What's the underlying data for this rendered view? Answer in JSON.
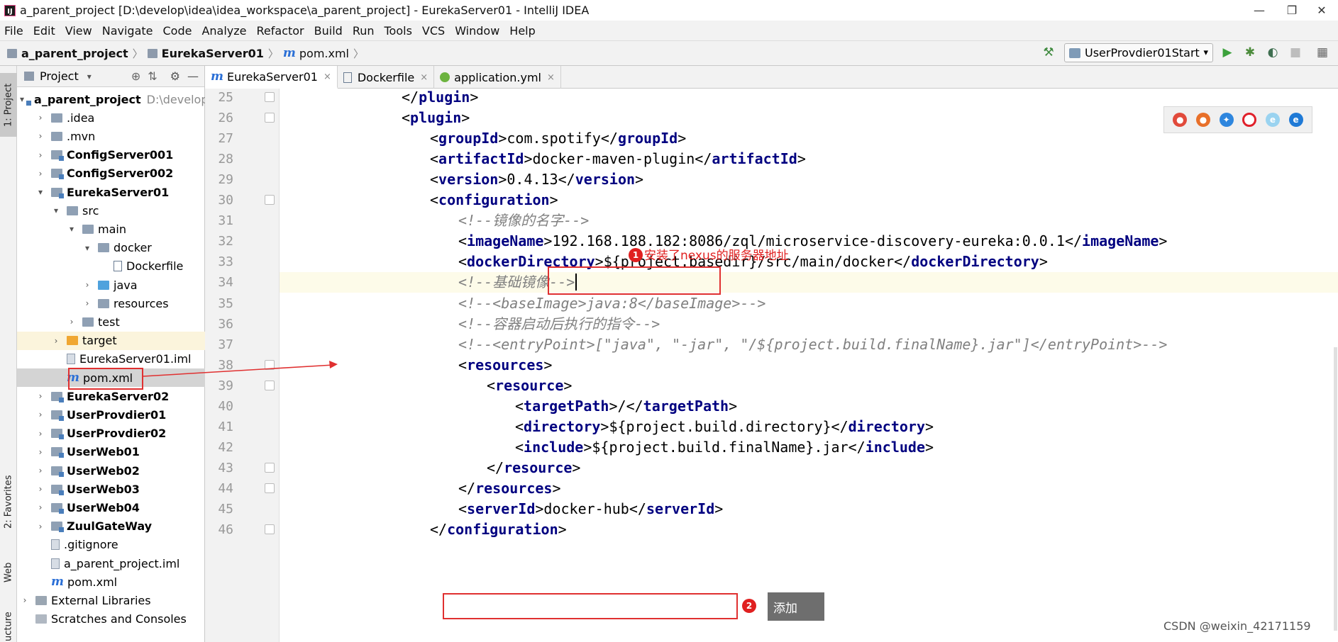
{
  "window": {
    "title": "a_parent_project [D:\\develop\\idea\\idea_workspace\\a_parent_project] - EurekaServer01 - IntelliJ IDEA",
    "controls": {
      "minimize": "—",
      "maximize": "❐",
      "close": "✕"
    }
  },
  "menu": [
    "File",
    "Edit",
    "View",
    "Navigate",
    "Code",
    "Analyze",
    "Refactor",
    "Build",
    "Run",
    "Tools",
    "VCS",
    "Window",
    "Help"
  ],
  "breadcrumb": {
    "project": "a_parent_project",
    "module": "EurekaServer01",
    "file_icon": "m",
    "file": "pom.xml"
  },
  "toolbar": {
    "run_config": "UserProvdier01Start",
    "dropdown_glyph": "▾",
    "build_icon": "hammer-icon",
    "run_icon": "play-icon",
    "debug_icon": "bug-icon",
    "coverage_icon": "coverage-icon",
    "stop_icon": "stop-icon"
  },
  "side_tabs": {
    "project": "1: Project",
    "favorites": "2: Favorites",
    "web": "Web",
    "structure": "ucture"
  },
  "project_panel": {
    "title": "Project",
    "dropdown": "▾"
  },
  "tree": [
    {
      "label": "a_parent_project",
      "suffix": "D:\\develop",
      "bold": true,
      "depth": 0,
      "arrow": "▾",
      "icon": "folder-mod"
    },
    {
      "label": ".idea",
      "depth": 1,
      "arrow": "›",
      "icon": "folder"
    },
    {
      "label": ".mvn",
      "depth": 1,
      "arrow": "›",
      "icon": "folder"
    },
    {
      "label": "ConfigServer001",
      "bold": true,
      "depth": 1,
      "arrow": "›",
      "icon": "folder-mod"
    },
    {
      "label": "ConfigServer002",
      "bold": true,
      "depth": 1,
      "arrow": "›",
      "icon": "folder-mod"
    },
    {
      "label": "EurekaServer01",
      "bold": true,
      "depth": 1,
      "arrow": "▾",
      "icon": "folder-mod"
    },
    {
      "label": "src",
      "depth": 2,
      "arrow": "▾",
      "icon": "folder"
    },
    {
      "label": "main",
      "depth": 3,
      "arrow": "▾",
      "icon": "folder"
    },
    {
      "label": "docker",
      "depth": 4,
      "arrow": "▾",
      "icon": "folder"
    },
    {
      "label": "Dockerfile",
      "depth": 5,
      "arrow": "",
      "icon": "file-docker"
    },
    {
      "label": "java",
      "depth": 4,
      "arrow": "›",
      "icon": "folder-blue"
    },
    {
      "label": "resources",
      "depth": 4,
      "arrow": "›",
      "icon": "folder"
    },
    {
      "label": "test",
      "depth": 3,
      "arrow": "›",
      "icon": "folder"
    },
    {
      "label": "target",
      "depth": 2,
      "arrow": "›",
      "icon": "folder-orange",
      "highlight": true
    },
    {
      "label": "EurekaServer01.iml",
      "depth": 2,
      "arrow": "",
      "icon": "file"
    },
    {
      "label": "pom.xml",
      "depth": 2,
      "arrow": "",
      "icon": "m",
      "selected": true
    },
    {
      "label": "EurekaServer02",
      "bold": true,
      "depth": 1,
      "arrow": "›",
      "icon": "folder-mod"
    },
    {
      "label": "UserProvdier01",
      "bold": true,
      "depth": 1,
      "arrow": "›",
      "icon": "folder-mod"
    },
    {
      "label": "UserProvdier02",
      "bold": true,
      "depth": 1,
      "arrow": "›",
      "icon": "folder-mod"
    },
    {
      "label": "UserWeb01",
      "bold": true,
      "depth": 1,
      "arrow": "›",
      "icon": "folder-mod"
    },
    {
      "label": "UserWeb02",
      "bold": true,
      "depth": 1,
      "arrow": "›",
      "icon": "folder-mod"
    },
    {
      "label": "UserWeb03",
      "bold": true,
      "depth": 1,
      "arrow": "›",
      "icon": "folder-mod"
    },
    {
      "label": "UserWeb04",
      "bold": true,
      "depth": 1,
      "arrow": "›",
      "icon": "folder-mod"
    },
    {
      "label": "ZuulGateWay",
      "bold": true,
      "depth": 1,
      "arrow": "›",
      "icon": "folder-mod"
    },
    {
      "label": ".gitignore",
      "depth": 1,
      "arrow": "",
      "icon": "file"
    },
    {
      "label": "a_parent_project.iml",
      "depth": 1,
      "arrow": "",
      "icon": "file"
    },
    {
      "label": "pom.xml",
      "depth": 1,
      "arrow": "",
      "icon": "m"
    },
    {
      "label": "External Libraries",
      "depth": 0,
      "arrow": "›",
      "icon": "lib"
    },
    {
      "label": "Scratches and Consoles",
      "depth": 0,
      "arrow": "",
      "icon": "scratch"
    }
  ],
  "tabs": [
    {
      "icon": "m",
      "label": "EurekaServer01",
      "close": "×",
      "active": true
    },
    {
      "icon": "docker",
      "label": "Dockerfile",
      "close": "×"
    },
    {
      "icon": "yml",
      "label": "application.yml",
      "close": "×"
    }
  ],
  "code": [
    {
      "n": "25",
      "parts": [
        {
          "t": "br",
          "v": "</"
        },
        {
          "t": "tag",
          "v": "plugin"
        },
        {
          "t": "br",
          "v": ">"
        }
      ],
      "indent": 3
    },
    {
      "n": "26",
      "parts": [
        {
          "t": "br",
          "v": "<"
        },
        {
          "t": "tag",
          "v": "plugin"
        },
        {
          "t": "br",
          "v": ">"
        }
      ],
      "indent": 3
    },
    {
      "n": "27",
      "parts": [
        {
          "t": "br",
          "v": "<"
        },
        {
          "t": "tag",
          "v": "groupId"
        },
        {
          "t": "br",
          "v": ">"
        },
        {
          "t": "txt",
          "v": "com.spotify"
        },
        {
          "t": "br",
          "v": "</"
        },
        {
          "t": "tag",
          "v": "groupId"
        },
        {
          "t": "br",
          "v": ">"
        }
      ],
      "indent": 4
    },
    {
      "n": "28",
      "parts": [
        {
          "t": "br",
          "v": "<"
        },
        {
          "t": "tag",
          "v": "artifactId"
        },
        {
          "t": "br",
          "v": ">"
        },
        {
          "t": "txt",
          "v": "docker-maven-plugin"
        },
        {
          "t": "br",
          "v": "</"
        },
        {
          "t": "tag",
          "v": "artifactId"
        },
        {
          "t": "br",
          "v": ">"
        }
      ],
      "indent": 4
    },
    {
      "n": "29",
      "parts": [
        {
          "t": "br",
          "v": "<"
        },
        {
          "t": "tag",
          "v": "version"
        },
        {
          "t": "br",
          "v": ">"
        },
        {
          "t": "txt",
          "v": "0.4.13"
        },
        {
          "t": "br",
          "v": "</"
        },
        {
          "t": "tag",
          "v": "version"
        },
        {
          "t": "br",
          "v": ">"
        }
      ],
      "indent": 4
    },
    {
      "n": "30",
      "parts": [
        {
          "t": "br",
          "v": "<"
        },
        {
          "t": "tag",
          "v": "configuration"
        },
        {
          "t": "br",
          "v": ">"
        }
      ],
      "indent": 4
    },
    {
      "n": "31",
      "parts": [
        {
          "t": "cmt",
          "v": "<!--镜像的名字-->"
        }
      ],
      "indent": 5
    },
    {
      "n": "32",
      "parts": [
        {
          "t": "br",
          "v": "<"
        },
        {
          "t": "tag",
          "v": "imageName"
        },
        {
          "t": "br",
          "v": ">"
        },
        {
          "t": "txt",
          "v": "192.168.188.182:8086/zql/microservice-discovery-eureka:0.0.1"
        },
        {
          "t": "br",
          "v": "</"
        },
        {
          "t": "tag",
          "v": "imageName"
        },
        {
          "t": "br",
          "v": ">"
        }
      ],
      "indent": 5
    },
    {
      "n": "33",
      "parts": [
        {
          "t": "br",
          "v": "<"
        },
        {
          "t": "tag",
          "v": "dockerDirectory"
        },
        {
          "t": "br",
          "v": ">"
        },
        {
          "t": "txt",
          "v": "${project.basedir}/src/main/docker"
        },
        {
          "t": "br",
          "v": "</"
        },
        {
          "t": "tag",
          "v": "dockerDirectory"
        },
        {
          "t": "br",
          "v": ">"
        }
      ],
      "indent": 5
    },
    {
      "n": "34",
      "parts": [
        {
          "t": "cmt",
          "v": "<!--基础镜像-->"
        }
      ],
      "indent": 5,
      "current": true
    },
    {
      "n": "35",
      "parts": [
        {
          "t": "cmt",
          "v": "<!--<baseImage>java:8</baseImage>-->"
        }
      ],
      "indent": 5
    },
    {
      "n": "36",
      "parts": [
        {
          "t": "cmt",
          "v": "<!--容器启动后执行的指令-->"
        }
      ],
      "indent": 5
    },
    {
      "n": "37",
      "parts": [
        {
          "t": "cmt",
          "v": "<!--<entryPoint>[\"java\", \"-jar\", \"/${project.build.finalName}.jar\"]</entryPoint>-->"
        }
      ],
      "indent": 5
    },
    {
      "n": "38",
      "parts": [
        {
          "t": "br",
          "v": "<"
        },
        {
          "t": "tag",
          "v": "resources"
        },
        {
          "t": "br",
          "v": ">"
        }
      ],
      "indent": 5
    },
    {
      "n": "39",
      "parts": [
        {
          "t": "br",
          "v": "<"
        },
        {
          "t": "tag",
          "v": "resource"
        },
        {
          "t": "br",
          "v": ">"
        }
      ],
      "indent": 6
    },
    {
      "n": "40",
      "parts": [
        {
          "t": "br",
          "v": "<"
        },
        {
          "t": "tag",
          "v": "targetPath"
        },
        {
          "t": "br",
          "v": ">"
        },
        {
          "t": "txt",
          "v": "/"
        },
        {
          "t": "br",
          "v": "</"
        },
        {
          "t": "tag",
          "v": "targetPath"
        },
        {
          "t": "br",
          "v": ">"
        }
      ],
      "indent": 7
    },
    {
      "n": "41",
      "parts": [
        {
          "t": "br",
          "v": "<"
        },
        {
          "t": "tag",
          "v": "directory"
        },
        {
          "t": "br",
          "v": ">"
        },
        {
          "t": "txt",
          "v": "${project.build.directory}"
        },
        {
          "t": "br",
          "v": "</"
        },
        {
          "t": "tag",
          "v": "directory"
        },
        {
          "t": "br",
          "v": ">"
        }
      ],
      "indent": 7
    },
    {
      "n": "42",
      "parts": [
        {
          "t": "br",
          "v": "<"
        },
        {
          "t": "tag",
          "v": "include"
        },
        {
          "t": "br",
          "v": ">"
        },
        {
          "t": "txt",
          "v": "${project.build.finalName}.jar"
        },
        {
          "t": "br",
          "v": "</"
        },
        {
          "t": "tag",
          "v": "include"
        },
        {
          "t": "br",
          "v": ">"
        }
      ],
      "indent": 7
    },
    {
      "n": "43",
      "parts": [
        {
          "t": "br",
          "v": "</"
        },
        {
          "t": "tag",
          "v": "resource"
        },
        {
          "t": "br",
          "v": ">"
        }
      ],
      "indent": 6
    },
    {
      "n": "44",
      "parts": [
        {
          "t": "br",
          "v": "</"
        },
        {
          "t": "tag",
          "v": "resources"
        },
        {
          "t": "br",
          "v": ">"
        }
      ],
      "indent": 5
    },
    {
      "n": "45",
      "parts": [
        {
          "t": "br",
          "v": "<"
        },
        {
          "t": "tag",
          "v": "serverId"
        },
        {
          "t": "br",
          "v": ">"
        },
        {
          "t": "txt",
          "v": "docker-hub"
        },
        {
          "t": "br",
          "v": "</"
        },
        {
          "t": "tag",
          "v": "serverId"
        },
        {
          "t": "br",
          "v": ">"
        }
      ],
      "indent": 5
    },
    {
      "n": "46",
      "parts": [
        {
          "t": "br",
          "v": "</"
        },
        {
          "t": "tag",
          "v": "configuration"
        },
        {
          "t": "br",
          "v": ">"
        }
      ],
      "indent": 4
    }
  ],
  "annotations": {
    "one": {
      "num": "1",
      "text": "安装了nexus的服务器地址"
    },
    "two": {
      "num": "2",
      "text": "添加"
    }
  },
  "browser_icons": [
    "chrome-icon",
    "firefox-icon",
    "safari-icon",
    "opera-icon",
    "ie-icon",
    "edge-icon"
  ],
  "watermark": "CSDN @weixin_42171159",
  "colors": {
    "tag": "#000080",
    "comment": "#808080",
    "annotation": "#e02020",
    "current_line": "#fdfbe9"
  }
}
